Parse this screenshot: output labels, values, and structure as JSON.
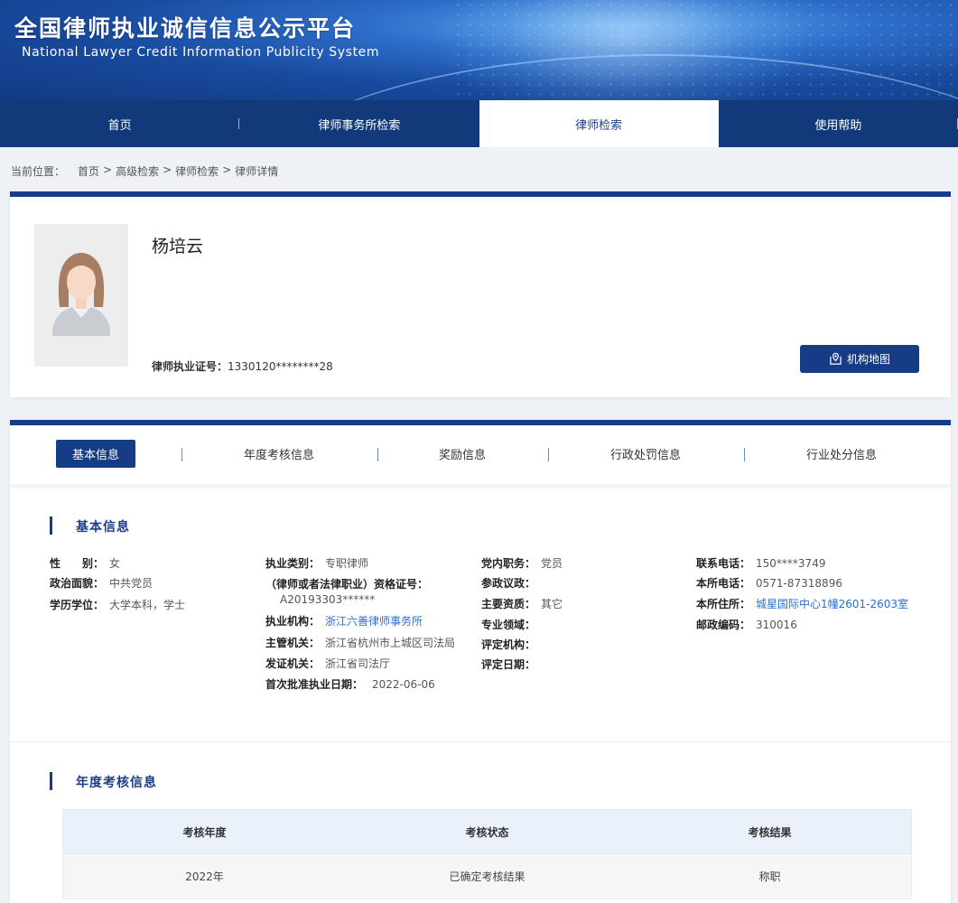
{
  "header": {
    "title_cn": "全国律师执业诚信信息公示平台",
    "title_en": "National Lawyer Credit Information Publicity System"
  },
  "nav": {
    "items": [
      {
        "label": "首页"
      },
      {
        "label": "律师事务所检索"
      },
      {
        "label": "律师检索",
        "active": true
      },
      {
        "label": "使用帮助"
      }
    ]
  },
  "breadcrumb": {
    "prefix": "当前位置：",
    "items": [
      "首页",
      ">",
      "高级检索",
      ">",
      "律师检索",
      ">",
      "律师详情"
    ]
  },
  "profile": {
    "name": "杨培云",
    "license_label": "律师执业证号：",
    "license_value": "1330120********28",
    "map_button": "机构地图"
  },
  "tabs": [
    {
      "label": "基本信息",
      "active": true
    },
    {
      "label": "年度考核信息"
    },
    {
      "label": "奖励信息"
    },
    {
      "label": "行政处罚信息"
    },
    {
      "label": "行业处分信息"
    }
  ],
  "basic": {
    "title": "基本信息",
    "col1": [
      {
        "k": "性　　别：",
        "v": "女"
      },
      {
        "k": "政治面貌：",
        "v": "中共党员"
      },
      {
        "k": "学历学位：",
        "v": "大学本科，学士"
      }
    ],
    "col2": {
      "practice_type_k": "执业类别：",
      "practice_type_v": "专职律师",
      "qual_k": "（律师或者法律职业）资格证号：",
      "qual_v": "A20193303******",
      "org_k": "执业机构：",
      "org_v": "浙江六善律师事务所",
      "authority_k": "主管机关：",
      "authority_v": "浙江省杭州市上城区司法局",
      "issuer_k": "发证机关：",
      "issuer_v": "浙江省司法厅",
      "first_date_k": "首次批准执业日期：",
      "first_date_v": "2022-06-06"
    },
    "col3": [
      {
        "k": "党内职务：",
        "v": "党员"
      },
      {
        "k": "参政议政：",
        "v": ""
      },
      {
        "k": "主要资质：",
        "v": "其它"
      },
      {
        "k": "专业领域：",
        "v": ""
      },
      {
        "k": "评定机构：",
        "v": ""
      },
      {
        "k": "评定日期：",
        "v": ""
      }
    ],
    "col4": [
      {
        "k": "联系电话：",
        "v": "150****3749",
        "link": false
      },
      {
        "k": "本所电话：",
        "v": "0571-87318896",
        "link": false
      },
      {
        "k": "本所住所：",
        "v": "城星国际中心1幢2601-2603室",
        "link": true
      },
      {
        "k": "邮政编码：",
        "v": "310016",
        "link": false
      }
    ]
  },
  "annual": {
    "title": "年度考核信息",
    "headers": [
      "考核年度",
      "考核状态",
      "考核结果"
    ],
    "rows": [
      [
        "2022年",
        "已确定考核结果",
        "称职"
      ]
    ]
  },
  "colors": {
    "nav_bg": "#123a7a",
    "accent": "#163c85",
    "link": "#2a6fd6"
  }
}
